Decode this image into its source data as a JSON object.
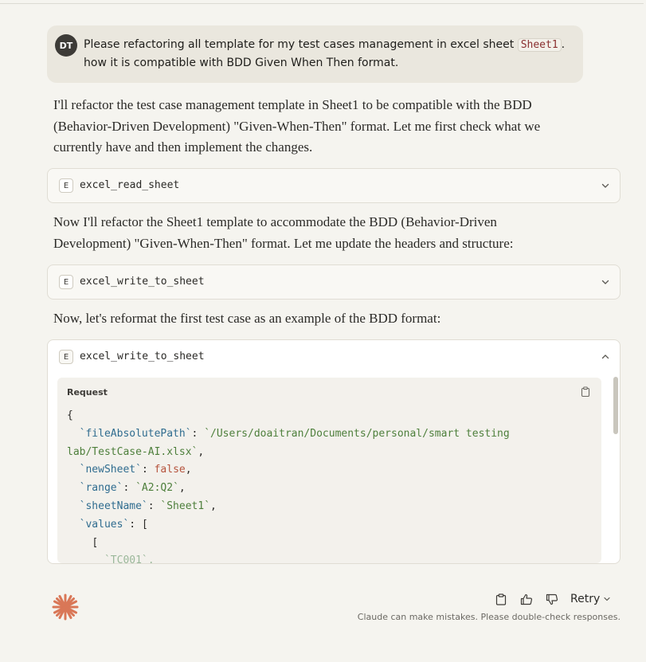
{
  "user_message": {
    "avatar_initials": "DT",
    "text_before_code": "Please refactoring all template for my test cases management in excel sheet ",
    "code": "Sheet1",
    "text_after_code": ". how it is compatible with BDD Given When Then format."
  },
  "assistant": {
    "para1": "I'll refactor the test case management template in Sheet1 to be compatible with the BDD (Behavior-Driven Development) \"Given-When-Then\" format. Let me first check what we currently have and then implement the changes.",
    "para2": "Now I'll refactor the Sheet1 template to accommodate the BDD (Behavior-Driven Development) \"Given-When-Then\" format. Let me update the headers and structure:",
    "para3": "Now, let's reformat the first test case as an example of the BDD format:"
  },
  "tools": [
    {
      "badge": "E",
      "name": "excel_read_sheet",
      "state": "collapsed"
    },
    {
      "badge": "E",
      "name": "excel_write_to_sheet",
      "state": "collapsed"
    },
    {
      "badge": "E",
      "name": "excel_write_to_sheet",
      "state": "expanded"
    }
  ],
  "request": {
    "label": "Request",
    "open_brace": "{",
    "file_key": "`fileAbsolutePath`",
    "file_value_line1": "`/Users/doaitran/Documents/personal/smart testing",
    "file_value_line2": "lab/TestCase-AI.xlsx`",
    "newsheet_key": "`newSheet`",
    "newsheet_value": "false",
    "range_key": "`range`",
    "range_value": "`A2:Q2`",
    "sheetname_key": "`sheetName`",
    "sheetname_value": "`Sheet1`",
    "values_key": "`values`",
    "open_bracket": "[",
    "inner_bracket": "[",
    "first_value": "`TC001`,"
  },
  "footer": {
    "retry_label": "Retry",
    "disclaimer": "Claude can make mistakes. Please double-check responses."
  },
  "colors": {
    "background": "#f5f4ef",
    "user_bubble": "#eae7de",
    "logo": "#d97757"
  }
}
